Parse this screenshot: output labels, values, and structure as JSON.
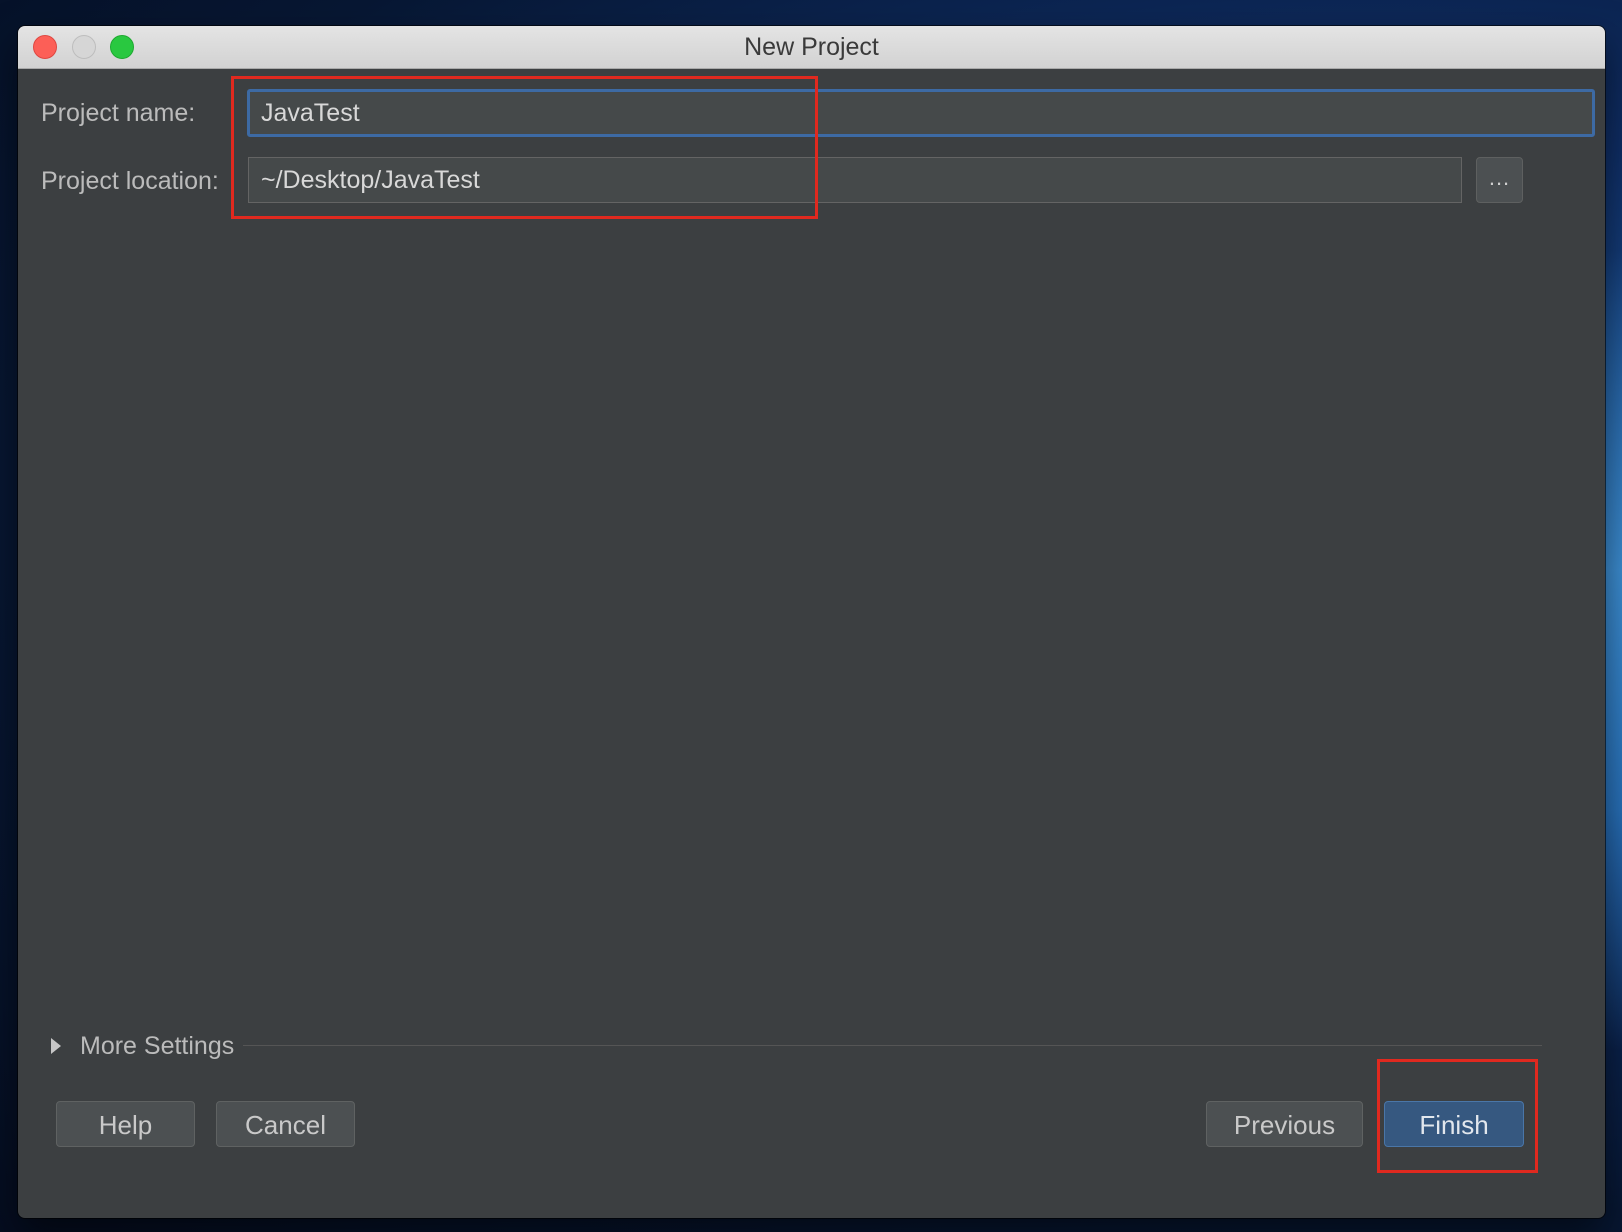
{
  "window": {
    "title": "New Project"
  },
  "form": {
    "project_name_label": "Project name:",
    "project_name_value": "JavaTest",
    "project_location_label": "Project location:",
    "project_location_value": "~/Desktop/JavaTest",
    "browse_label": "..."
  },
  "more_settings": {
    "label": "More Settings",
    "expanded": false
  },
  "buttons": {
    "help": "Help",
    "cancel": "Cancel",
    "previous": "Previous",
    "finish": "Finish"
  },
  "colors": {
    "dialog_background": "#3c3f41",
    "input_background": "#45494a",
    "focus_border": "#3d6aa4",
    "primary_button": "#365880",
    "annotation_red": "#e0291f"
  },
  "icons": [
    "close-window-icon",
    "minimize-window-icon",
    "zoom-window-icon",
    "disclosure-triangle-icon"
  ]
}
